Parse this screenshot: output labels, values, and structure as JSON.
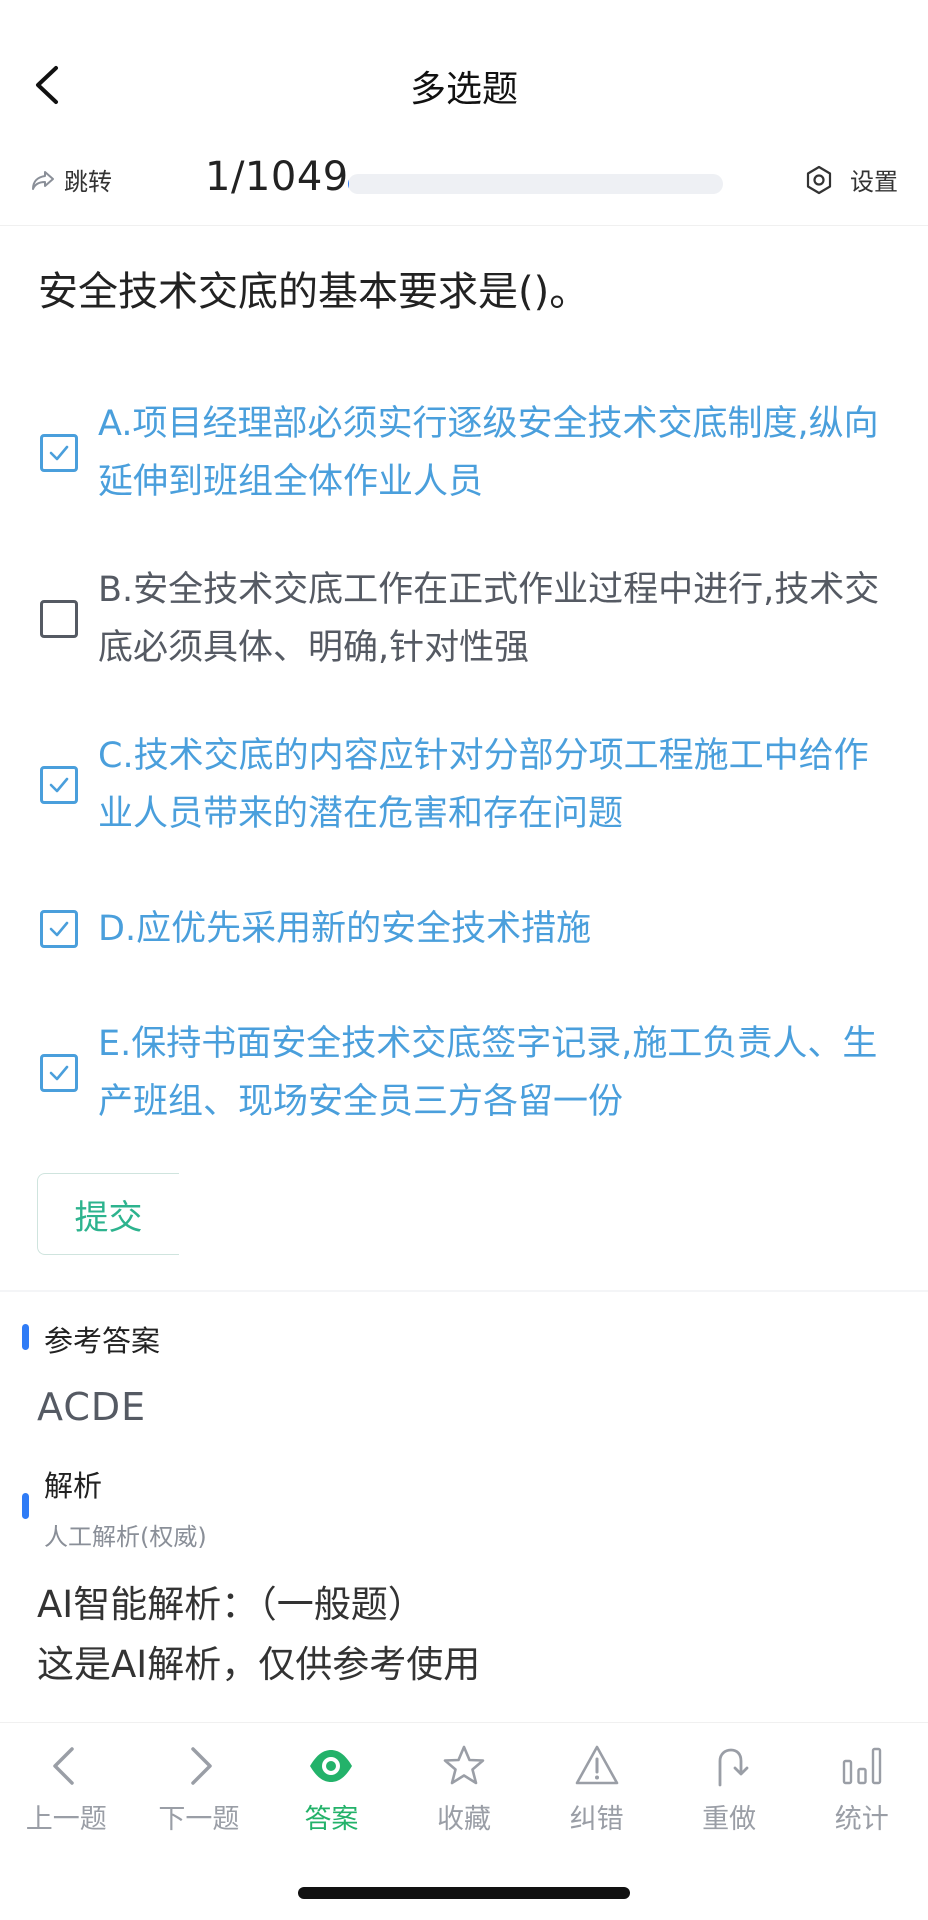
{
  "header": {
    "title": "多选题"
  },
  "progress": {
    "jump_label": "跳转",
    "counter": "1/1049",
    "current": 1,
    "total": 1049,
    "settings_label": "设置"
  },
  "question": {
    "text": "安全技术交底的基本要求是()。"
  },
  "options": [
    {
      "text": "A.项目经理部必须实行逐级安全技术交底制度,纵向延伸到班组全体作业人员",
      "checked": true
    },
    {
      "text": "B.安全技术交底工作在正式作业过程中进行,技术交底必须具体、明确,针对性强",
      "checked": false
    },
    {
      "text": "C.技术交底的内容应针对分部分项工程施工中给作业人员带来的潜在危害和存在问题",
      "checked": true
    },
    {
      "text": "D.应优先采用新的安全技术措施",
      "checked": true
    },
    {
      "text": "E.保持书面安全技术交底签字记录,施工负责人、生产班组、现场安全员三方各留一份",
      "checked": true
    }
  ],
  "submit": {
    "label": "提交"
  },
  "answer": {
    "label": "参考答案",
    "value": "ACDE"
  },
  "analysis": {
    "label": "解析",
    "sub_label": "人工解析(权威)",
    "ai_line1": "AI智能解析：（一般题）",
    "ai_line2": "这是AI解析，仅供参考使用"
  },
  "tabs": [
    {
      "label": "上一题",
      "icon": "chevron-left-icon",
      "active": false
    },
    {
      "label": "下一题",
      "icon": "chevron-right-icon",
      "active": false
    },
    {
      "label": "答案",
      "icon": "eye-icon",
      "active": true
    },
    {
      "label": "收藏",
      "icon": "star-icon",
      "active": false
    },
    {
      "label": "纠错",
      "icon": "warning-icon",
      "active": false
    },
    {
      "label": "重做",
      "icon": "redo-icon",
      "active": false
    },
    {
      "label": "统计",
      "icon": "bar-chart-icon",
      "active": false
    }
  ],
  "colors": {
    "accent_blue": "#4a9fdc",
    "progress_blue": "#2f7cf6",
    "active_green": "#23b26a",
    "submit_green": "#2db38e",
    "inactive_gray": "#9a9ea6"
  }
}
